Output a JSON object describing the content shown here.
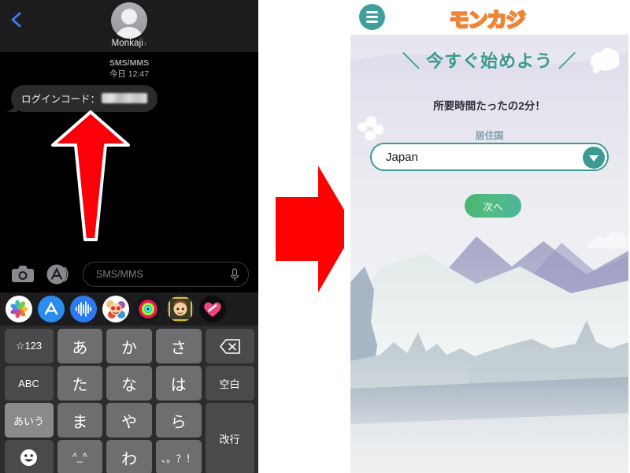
{
  "messages_app": {
    "nav": {
      "back_icon": "back-chevron-icon",
      "avatar_icon": "contact-avatar",
      "contact_name": "Monkaji",
      "contact_chevron": "›"
    },
    "thread_meta": {
      "service": "SMS/MMS",
      "timestamp": "今日 12:47"
    },
    "bubble": {
      "text": "ログインコード：",
      "redacted_value": ""
    },
    "annotation": {
      "up_arrow_icon": "red-up-arrow",
      "arrow_color": "#fb0008",
      "arrow_outline": "#ffffff"
    },
    "input_bar": {
      "camera_icon": "camera-icon",
      "appstore_icon": "app-store-icon",
      "placeholder": "SMS/MMS",
      "mic_icon": "microphone-icon"
    },
    "app_drawer": [
      {
        "name": "photos-app-icon",
        "label": "Photos"
      },
      {
        "name": "app-store-app-icon",
        "label": "App Store"
      },
      {
        "name": "audio-message-app-icon",
        "label": "Audio"
      },
      {
        "name": "memoji-stickers-app-icon",
        "label": "Memoji Stickers"
      },
      {
        "name": "activity-rings-app-icon",
        "label": "Fitness"
      },
      {
        "name": "animoji-app-icon",
        "label": "Animoji"
      },
      {
        "name": "digital-touch-app-icon",
        "label": "Digital Touch"
      }
    ],
    "keyboard": {
      "rows": [
        [
          {
            "label": "☆123",
            "name": "key-numbers",
            "style": "fn-dark"
          },
          {
            "label": "あ",
            "name": "key-a",
            "style": "light"
          },
          {
            "label": "か",
            "name": "key-ka",
            "style": "light"
          },
          {
            "label": "さ",
            "name": "key-sa",
            "style": "light"
          },
          {
            "label": "⌫",
            "name": "key-backspace",
            "style": "fn-dark"
          }
        ],
        [
          {
            "label": "ABC",
            "name": "key-abc",
            "style": "fn-dark"
          },
          {
            "label": "た",
            "name": "key-ta",
            "style": "light"
          },
          {
            "label": "な",
            "name": "key-na",
            "style": "light"
          },
          {
            "label": "は",
            "name": "key-ha",
            "style": "light"
          },
          {
            "label": "空白",
            "name": "key-space",
            "style": "fn-dark"
          }
        ],
        [
          {
            "label": "あいう",
            "name": "key-kana-mode",
            "style": "fn-lighter"
          },
          {
            "label": "ま",
            "name": "key-ma",
            "style": "light"
          },
          {
            "label": "や",
            "name": "key-ya",
            "style": "light"
          },
          {
            "label": "ら",
            "name": "key-ra",
            "style": "light"
          },
          {
            "label": "改行",
            "name": "key-return",
            "style": "fn-dark"
          }
        ],
        [
          {
            "label": "☺",
            "name": "key-emoji",
            "style": "fn-dark"
          },
          {
            "label": "^_^",
            "name": "key-kaomoji",
            "style": "small"
          },
          {
            "label": "わ",
            "name": "key-wa",
            "style": "light"
          },
          {
            "label": "、。？！",
            "name": "key-punctuation",
            "style": "small"
          }
        ]
      ]
    }
  },
  "transition": {
    "arrow_icon": "red-right-arrow",
    "arrow_color": "#fe0000"
  },
  "casino_app": {
    "topbar": {
      "menu_icon": "hamburger-menu-icon",
      "brand": "モンカジ"
    },
    "signup": {
      "headline": "＼ 今すぐ始めよう ／",
      "subline": "所要時間たったの2分！",
      "field_label": "居住国",
      "country_value": "Japan",
      "dropdown_icon": "chevron-down-icon",
      "next_label": "次へ"
    },
    "decor": {
      "cloud_icon": "cloud-decoration",
      "flower_icon": "flower-decoration",
      "mountains_icon": "mountain-landscape"
    },
    "colors": {
      "brand_orange": "#ef8434",
      "teal": "#3c9a93",
      "headline_teal": "#3d9a8f",
      "button_green": "#4fba7c",
      "label_blue": "#7f9fb0"
    }
  }
}
